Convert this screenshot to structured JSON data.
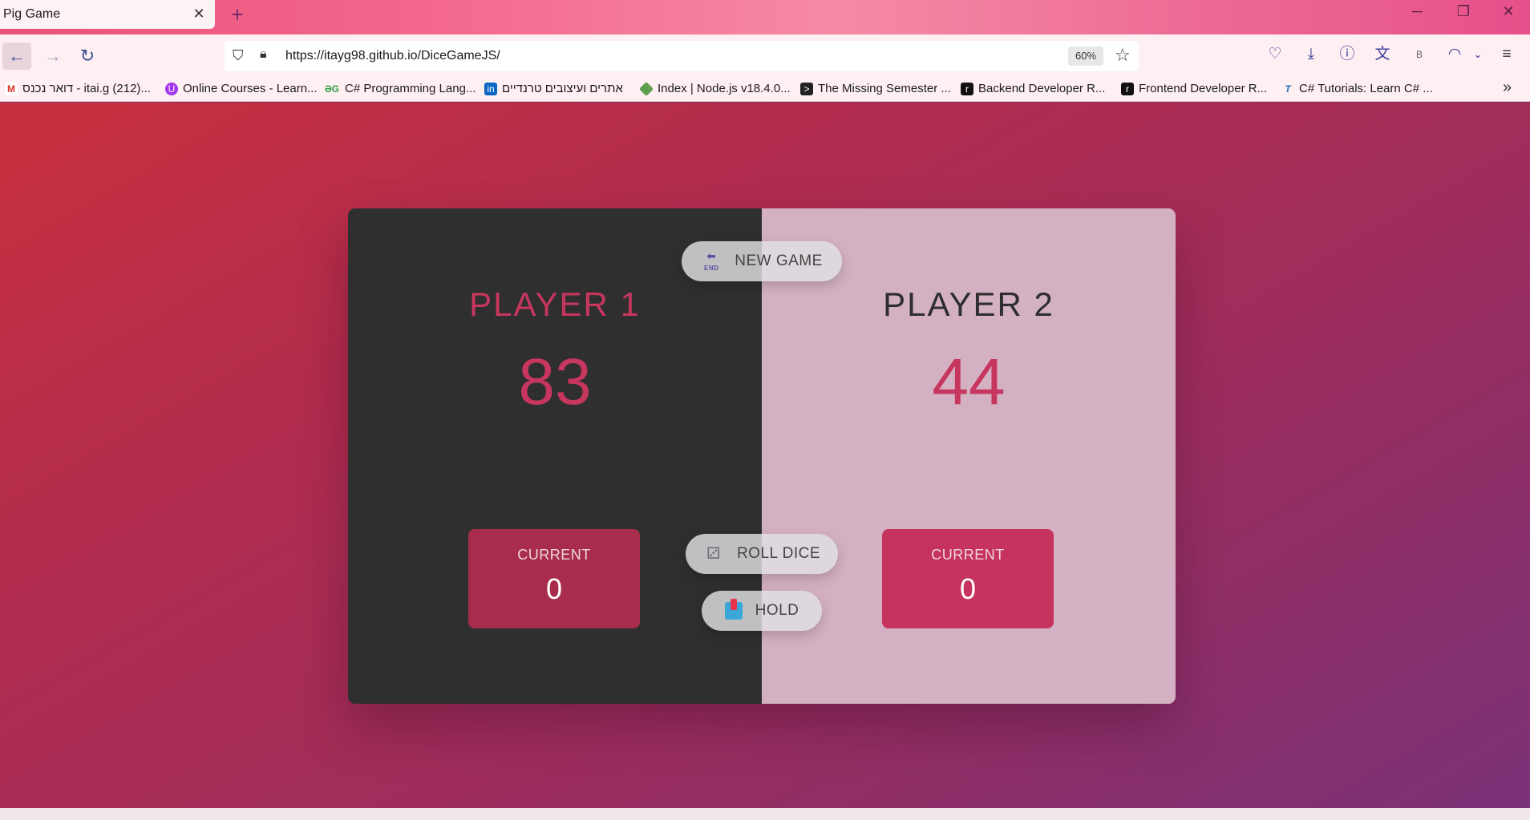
{
  "browser": {
    "tab_title": "Pig Game",
    "tab_close": "✕",
    "new_tab": "+",
    "window_controls": {
      "minimize": "─",
      "restore": "❐",
      "close": "✕"
    },
    "url": "https://itayg98.github.io/DiceGameJS/",
    "zoom": "60%",
    "bookmarks": [
      {
        "label": "דואר נכנס - itai.g (212)...",
        "icon": "gmail-icon",
        "color": "#d93025"
      },
      {
        "label": "Online Courses - Learn...",
        "icon": "udemy-icon",
        "color": "#a435f0"
      },
      {
        "label": "C# Programming Lang...",
        "icon": "gg-icon",
        "color": "#2ea043"
      },
      {
        "label": "אתרים ועיצובים טרנדיים",
        "icon": "linkedin-icon",
        "color": "#0a66c2"
      },
      {
        "label": "Index | Node.js v18.4.0...",
        "icon": "nodejs-icon",
        "color": "#5fa04e"
      },
      {
        "label": "The Missing Semester ...",
        "icon": "terminal-icon",
        "color": "#222222"
      },
      {
        "label": "Backend Developer R...",
        "icon": "roadmap-icon",
        "color": "#111111"
      },
      {
        "label": "Frontend Developer R...",
        "icon": "roadmap-icon",
        "color": "#111111"
      },
      {
        "label": "C# Tutorials: Learn C# ...",
        "icon": "tutorials-icon",
        "color": "#2d6fb0"
      }
    ],
    "overflow": "»"
  },
  "game": {
    "new_game_label": "NEW GAME",
    "roll_dice_label": "ROLL DICE",
    "hold_label": "HOLD",
    "end_icon_text": "END",
    "player1": {
      "name": "PLAYER 1",
      "score": "83",
      "current_label": "CURRENT",
      "current_score": "0"
    },
    "player2": {
      "name": "PLAYER 2",
      "score": "44",
      "current_label": "CURRENT",
      "current_score": "0"
    }
  },
  "colors": {
    "accent": "#c7365f",
    "player1_bg": "#2f2f2f",
    "player2_bg": "#d4b1c2"
  }
}
